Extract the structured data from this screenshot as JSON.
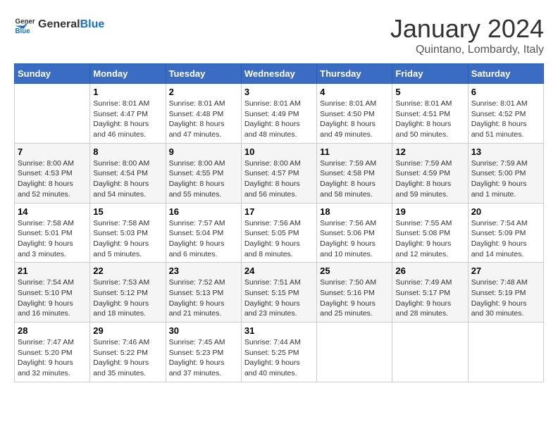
{
  "header": {
    "logo_general": "General",
    "logo_blue": "Blue",
    "month_title": "January 2024",
    "location": "Quintano, Lombardy, Italy"
  },
  "weekdays": [
    "Sunday",
    "Monday",
    "Tuesday",
    "Wednesday",
    "Thursday",
    "Friday",
    "Saturday"
  ],
  "weeks": [
    [
      {
        "day": "",
        "sunrise": "",
        "sunset": "",
        "daylight": ""
      },
      {
        "day": "1",
        "sunrise": "Sunrise: 8:01 AM",
        "sunset": "Sunset: 4:47 PM",
        "daylight": "Daylight: 8 hours and 46 minutes."
      },
      {
        "day": "2",
        "sunrise": "Sunrise: 8:01 AM",
        "sunset": "Sunset: 4:48 PM",
        "daylight": "Daylight: 8 hours and 47 minutes."
      },
      {
        "day": "3",
        "sunrise": "Sunrise: 8:01 AM",
        "sunset": "Sunset: 4:49 PM",
        "daylight": "Daylight: 8 hours and 48 minutes."
      },
      {
        "day": "4",
        "sunrise": "Sunrise: 8:01 AM",
        "sunset": "Sunset: 4:50 PM",
        "daylight": "Daylight: 8 hours and 49 minutes."
      },
      {
        "day": "5",
        "sunrise": "Sunrise: 8:01 AM",
        "sunset": "Sunset: 4:51 PM",
        "daylight": "Daylight: 8 hours and 50 minutes."
      },
      {
        "day": "6",
        "sunrise": "Sunrise: 8:01 AM",
        "sunset": "Sunset: 4:52 PM",
        "daylight": "Daylight: 8 hours and 51 minutes."
      }
    ],
    [
      {
        "day": "7",
        "sunrise": "Sunrise: 8:00 AM",
        "sunset": "Sunset: 4:53 PM",
        "daylight": "Daylight: 8 hours and 52 minutes."
      },
      {
        "day": "8",
        "sunrise": "Sunrise: 8:00 AM",
        "sunset": "Sunset: 4:54 PM",
        "daylight": "Daylight: 8 hours and 54 minutes."
      },
      {
        "day": "9",
        "sunrise": "Sunrise: 8:00 AM",
        "sunset": "Sunset: 4:55 PM",
        "daylight": "Daylight: 8 hours and 55 minutes."
      },
      {
        "day": "10",
        "sunrise": "Sunrise: 8:00 AM",
        "sunset": "Sunset: 4:57 PM",
        "daylight": "Daylight: 8 hours and 56 minutes."
      },
      {
        "day": "11",
        "sunrise": "Sunrise: 7:59 AM",
        "sunset": "Sunset: 4:58 PM",
        "daylight": "Daylight: 8 hours and 58 minutes."
      },
      {
        "day": "12",
        "sunrise": "Sunrise: 7:59 AM",
        "sunset": "Sunset: 4:59 PM",
        "daylight": "Daylight: 8 hours and 59 minutes."
      },
      {
        "day": "13",
        "sunrise": "Sunrise: 7:59 AM",
        "sunset": "Sunset: 5:00 PM",
        "daylight": "Daylight: 9 hours and 1 minute."
      }
    ],
    [
      {
        "day": "14",
        "sunrise": "Sunrise: 7:58 AM",
        "sunset": "Sunset: 5:01 PM",
        "daylight": "Daylight: 9 hours and 3 minutes."
      },
      {
        "day": "15",
        "sunrise": "Sunrise: 7:58 AM",
        "sunset": "Sunset: 5:03 PM",
        "daylight": "Daylight: 9 hours and 5 minutes."
      },
      {
        "day": "16",
        "sunrise": "Sunrise: 7:57 AM",
        "sunset": "Sunset: 5:04 PM",
        "daylight": "Daylight: 9 hours and 6 minutes."
      },
      {
        "day": "17",
        "sunrise": "Sunrise: 7:56 AM",
        "sunset": "Sunset: 5:05 PM",
        "daylight": "Daylight: 9 hours and 8 minutes."
      },
      {
        "day": "18",
        "sunrise": "Sunrise: 7:56 AM",
        "sunset": "Sunset: 5:06 PM",
        "daylight": "Daylight: 9 hours and 10 minutes."
      },
      {
        "day": "19",
        "sunrise": "Sunrise: 7:55 AM",
        "sunset": "Sunset: 5:08 PM",
        "daylight": "Daylight: 9 hours and 12 minutes."
      },
      {
        "day": "20",
        "sunrise": "Sunrise: 7:54 AM",
        "sunset": "Sunset: 5:09 PM",
        "daylight": "Daylight: 9 hours and 14 minutes."
      }
    ],
    [
      {
        "day": "21",
        "sunrise": "Sunrise: 7:54 AM",
        "sunset": "Sunset: 5:10 PM",
        "daylight": "Daylight: 9 hours and 16 minutes."
      },
      {
        "day": "22",
        "sunrise": "Sunrise: 7:53 AM",
        "sunset": "Sunset: 5:12 PM",
        "daylight": "Daylight: 9 hours and 18 minutes."
      },
      {
        "day": "23",
        "sunrise": "Sunrise: 7:52 AM",
        "sunset": "Sunset: 5:13 PM",
        "daylight": "Daylight: 9 hours and 21 minutes."
      },
      {
        "day": "24",
        "sunrise": "Sunrise: 7:51 AM",
        "sunset": "Sunset: 5:15 PM",
        "daylight": "Daylight: 9 hours and 23 minutes."
      },
      {
        "day": "25",
        "sunrise": "Sunrise: 7:50 AM",
        "sunset": "Sunset: 5:16 PM",
        "daylight": "Daylight: 9 hours and 25 minutes."
      },
      {
        "day": "26",
        "sunrise": "Sunrise: 7:49 AM",
        "sunset": "Sunset: 5:17 PM",
        "daylight": "Daylight: 9 hours and 28 minutes."
      },
      {
        "day": "27",
        "sunrise": "Sunrise: 7:48 AM",
        "sunset": "Sunset: 5:19 PM",
        "daylight": "Daylight: 9 hours and 30 minutes."
      }
    ],
    [
      {
        "day": "28",
        "sunrise": "Sunrise: 7:47 AM",
        "sunset": "Sunset: 5:20 PM",
        "daylight": "Daylight: 9 hours and 32 minutes."
      },
      {
        "day": "29",
        "sunrise": "Sunrise: 7:46 AM",
        "sunset": "Sunset: 5:22 PM",
        "daylight": "Daylight: 9 hours and 35 minutes."
      },
      {
        "day": "30",
        "sunrise": "Sunrise: 7:45 AM",
        "sunset": "Sunset: 5:23 PM",
        "daylight": "Daylight: 9 hours and 37 minutes."
      },
      {
        "day": "31",
        "sunrise": "Sunrise: 7:44 AM",
        "sunset": "Sunset: 5:25 PM",
        "daylight": "Daylight: 9 hours and 40 minutes."
      },
      {
        "day": "",
        "sunrise": "",
        "sunset": "",
        "daylight": ""
      },
      {
        "day": "",
        "sunrise": "",
        "sunset": "",
        "daylight": ""
      },
      {
        "day": "",
        "sunrise": "",
        "sunset": "",
        "daylight": ""
      }
    ]
  ]
}
